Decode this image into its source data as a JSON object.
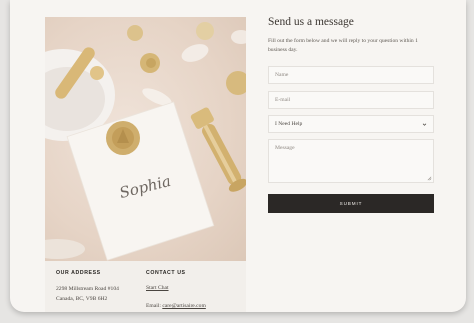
{
  "form": {
    "title": "Send us a message",
    "description": "Fill out the form below and we will reply to your question within 1 business day.",
    "name_placeholder": "Name",
    "email_placeholder": "E-mail",
    "select_value": "I Need Help",
    "message_placeholder": "Message",
    "submit_label": "SUBMIT"
  },
  "photo": {
    "signature_text": "Sophia"
  },
  "contact_info": {
    "address_heading": "OUR ADDRESS",
    "address_line1": "2298 Millstream Road #104",
    "address_line2": "Canada, BC, V9B 6H2",
    "contact_heading": "CONTACT US",
    "chat_link": "Start Chat",
    "email_label": "Email: ",
    "email_value": "care@artisaire.com"
  },
  "colors": {
    "background": "#f7f5f2",
    "button": "#2b2826",
    "text_dark": "#3d3833",
    "wax_gold": "#c9a86a"
  }
}
